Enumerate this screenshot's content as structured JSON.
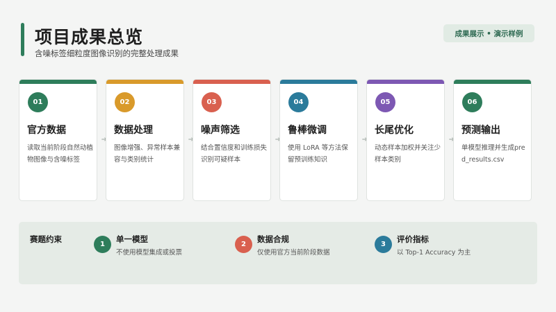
{
  "header": {
    "title": "项目成果总览",
    "subtitle": "含噪标签细粒度图像识别的完整处理成果",
    "badge": "成果展示 • 演示样例",
    "accent_color": "#2e7d5b"
  },
  "steps": [
    {
      "num": "01",
      "title": "官方数据",
      "desc": "读取当前阶段自然动植物图像与含噪标签",
      "color": "#2e7d5b"
    },
    {
      "num": "02",
      "title": "数据处理",
      "desc": "图像增强、异常样本兼容与类别统计",
      "color": "#d99a2b"
    },
    {
      "num": "03",
      "title": "噪声筛选",
      "desc": "结合置信度和训练损失识别可疑样本",
      "color": "#d9604f"
    },
    {
      "num": "04",
      "title": "鲁棒微调",
      "desc": "使用 LoRA 等方法保留预训练知识",
      "color": "#2b7b9b"
    },
    {
      "num": "05",
      "title": "长尾优化",
      "desc": "动态样本加权并关注少样本类别",
      "color": "#7d58b3"
    },
    {
      "num": "06",
      "title": "预测输出",
      "desc": "单模型推理并生成pred_results.csv",
      "color": "#2e7d5b"
    }
  ],
  "arrow_glyph": "➔",
  "constraints": {
    "label": "赛题约束",
    "items": [
      {
        "num": "1",
        "title": "单一模型",
        "desc": "不使用模型集成或投票",
        "color": "#2e7d5b"
      },
      {
        "num": "2",
        "title": "数据合规",
        "desc": "仅使用官方当前阶段数据",
        "color": "#d9604f"
      },
      {
        "num": "3",
        "title": "评价指标",
        "desc": "以 Top-1 Accuracy 为主",
        "color": "#2b7b9b"
      }
    ]
  }
}
